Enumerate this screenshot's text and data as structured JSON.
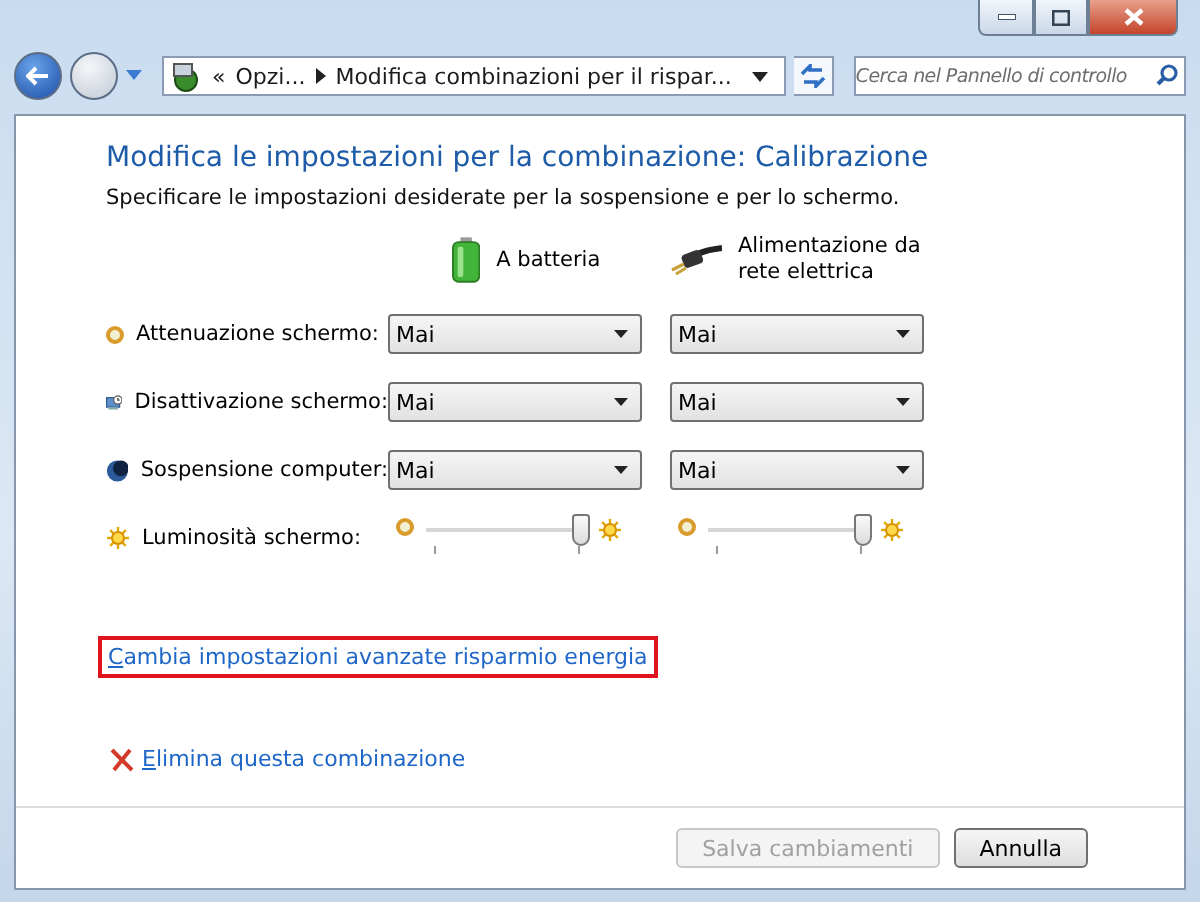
{
  "address_bar": {
    "overflow": "«",
    "crumbs": [
      "Opzi...",
      "Modifica combinazioni per il rispar..."
    ]
  },
  "search": {
    "placeholder": "Cerca nel Pannello di controllo"
  },
  "heading": "Modifica le impostazioni per la combinazione: Calibrazione",
  "description": "Specificare le impostazioni desiderate per la sospensione e per lo schermo.",
  "columns": [
    {
      "kind": "battery",
      "label": "A batteria"
    },
    {
      "kind": "plug",
      "label": "Alimentazione da rete elettrica"
    }
  ],
  "settings": [
    {
      "kind": "dropdown",
      "label": "Attenuazione schermo:",
      "values": [
        "Mai",
        "Mai"
      ]
    },
    {
      "kind": "dropdown",
      "label": "Disattivazione schermo:",
      "values": [
        "Mai",
        "Mai"
      ]
    },
    {
      "kind": "dropdown",
      "label": "Sospensione computer:",
      "values": [
        "Mai",
        "Mai"
      ]
    },
    {
      "kind": "slider",
      "label": "Luminosità schermo:",
      "sliders": [
        {
          "level": 0.97
        },
        {
          "level": 0.97
        }
      ]
    }
  ],
  "advanced_link": {
    "text": "Cambia impostazioni avanzate risparmio energia",
    "highlighted": true
  },
  "delete_link": {
    "text": "Elimina questa combinazione"
  },
  "buttons": [
    {
      "label": "Salva cambiamenti",
      "disabled": true
    },
    {
      "label": "Annulla",
      "disabled": false
    }
  ]
}
